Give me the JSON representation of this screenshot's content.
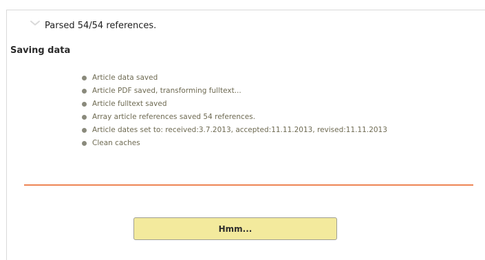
{
  "status": {
    "parsed_text": "Parsed 54/54 references.",
    "icon": "chevron-down-icon"
  },
  "section": {
    "title": "Saving data",
    "steps": [
      {
        "label": "Article data saved"
      },
      {
        "label": "Article PDF saved, transforming fulltext..."
      },
      {
        "label": "Article fulltext saved"
      },
      {
        "label": "Array article references saved 54 references."
      },
      {
        "label": "Article dates set to: received:3.7.2013, accepted:11.11.2013, revised:11.11.2013"
      },
      {
        "label": "Clean caches"
      }
    ]
  },
  "actions": {
    "hmm_label": "Hmm..."
  },
  "colors": {
    "divider": "#ee8454",
    "button_background": "#f3ea9d",
    "step_text": "#6e6a52"
  }
}
